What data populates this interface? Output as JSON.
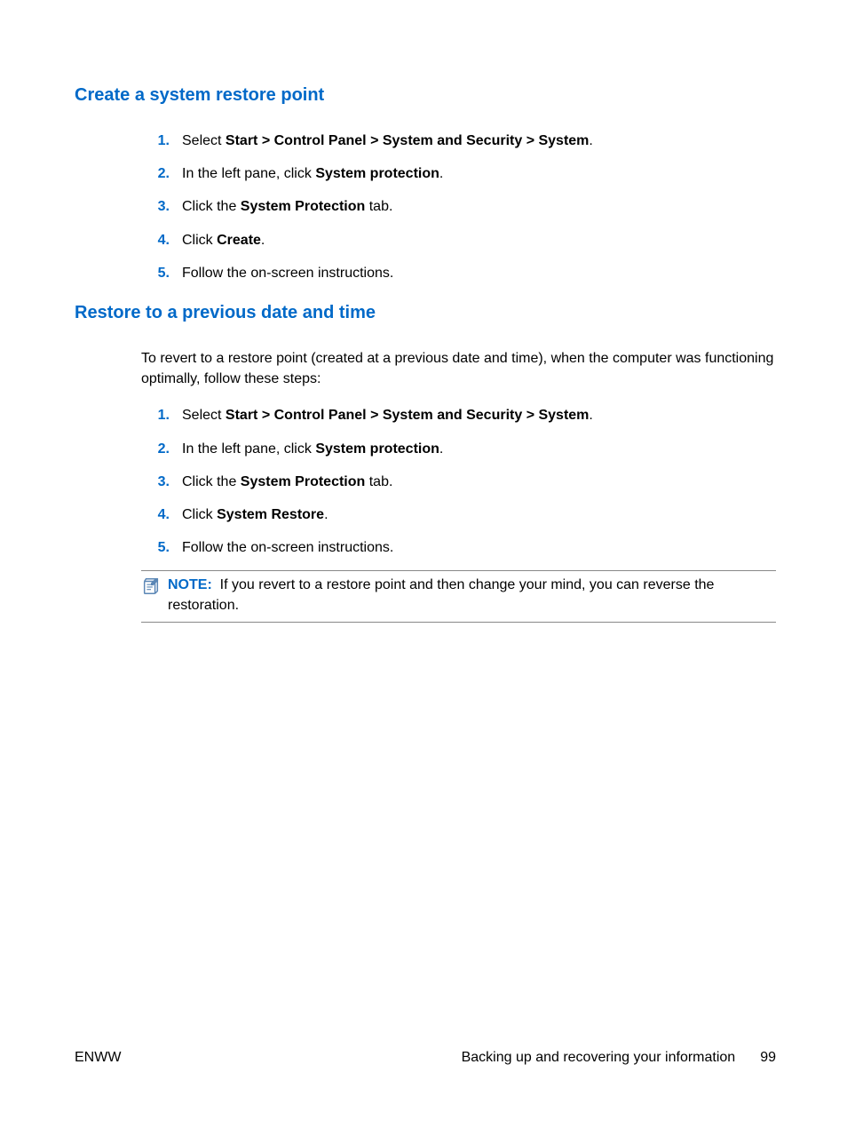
{
  "section1": {
    "heading": "Create a system restore point",
    "steps": [
      {
        "num": "1.",
        "pre": "Select ",
        "bold": "Start > Control Panel > System and Security > System",
        "post": "."
      },
      {
        "num": "2.",
        "pre": "In the left pane, click ",
        "bold": "System protection",
        "post": "."
      },
      {
        "num": "3.",
        "pre": "Click the ",
        "bold": "System Protection",
        "post": " tab."
      },
      {
        "num": "4.",
        "pre": "Click ",
        "bold": "Create",
        "post": "."
      },
      {
        "num": "5.",
        "pre": "Follow the on-screen instructions.",
        "bold": "",
        "post": ""
      }
    ]
  },
  "section2": {
    "heading": "Restore to a previous date and time",
    "intro": "To revert to a restore point (created at a previous date and time), when the computer was functioning optimally, follow these steps:",
    "steps": [
      {
        "num": "1.",
        "pre": "Select ",
        "bold": "Start > Control Panel > System and Security > System",
        "post": "."
      },
      {
        "num": "2.",
        "pre": "In the left pane, click ",
        "bold": "System protection",
        "post": "."
      },
      {
        "num": "3.",
        "pre": "Click the ",
        "bold": "System Protection",
        "post": " tab."
      },
      {
        "num": "4.",
        "pre": "Click ",
        "bold": "System Restore",
        "post": "."
      },
      {
        "num": "5.",
        "pre": "Follow the on-screen instructions.",
        "bold": "",
        "post": ""
      }
    ],
    "note_label": "NOTE:",
    "note_text": "If you revert to a restore point and then change your mind, you can reverse the restoration."
  },
  "footer": {
    "left": "ENWW",
    "right_text": "Backing up and recovering your information",
    "page_num": "99"
  }
}
